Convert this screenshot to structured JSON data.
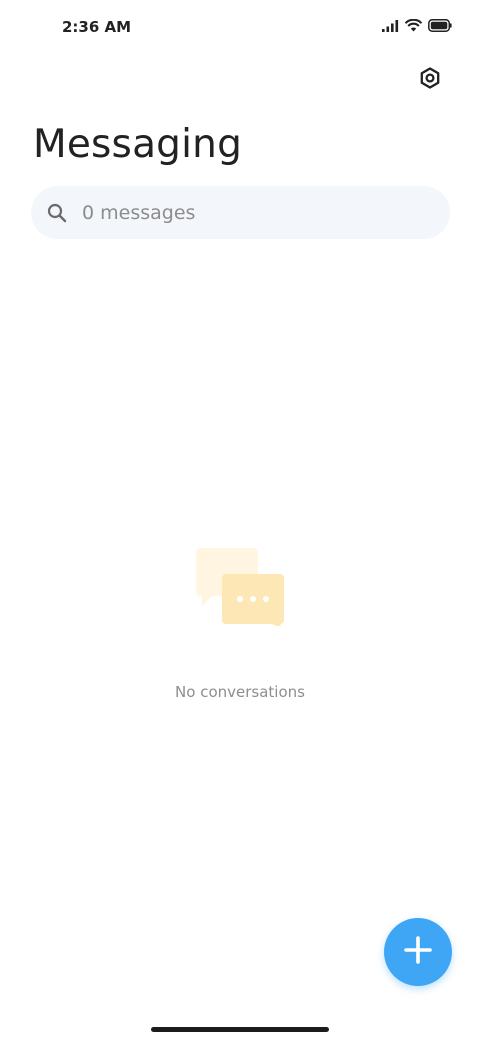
{
  "status_bar": {
    "time": "2:36 AM",
    "icons": [
      "signal-icon",
      "wifi-icon",
      "battery-icon"
    ]
  },
  "header": {
    "title": "Messaging",
    "settings_icon": "settings-icon"
  },
  "search": {
    "placeholder": "0 messages",
    "icon": "search-icon"
  },
  "empty_state": {
    "icon": "chat-bubbles-icon",
    "text": "No conversations"
  },
  "fab": {
    "icon": "plus-icon",
    "color": "#3fa6f5"
  },
  "colors": {
    "accent": "#3fa6f5",
    "search_background": "#f3f6fa",
    "empty_illustration": "#fde8b5"
  }
}
